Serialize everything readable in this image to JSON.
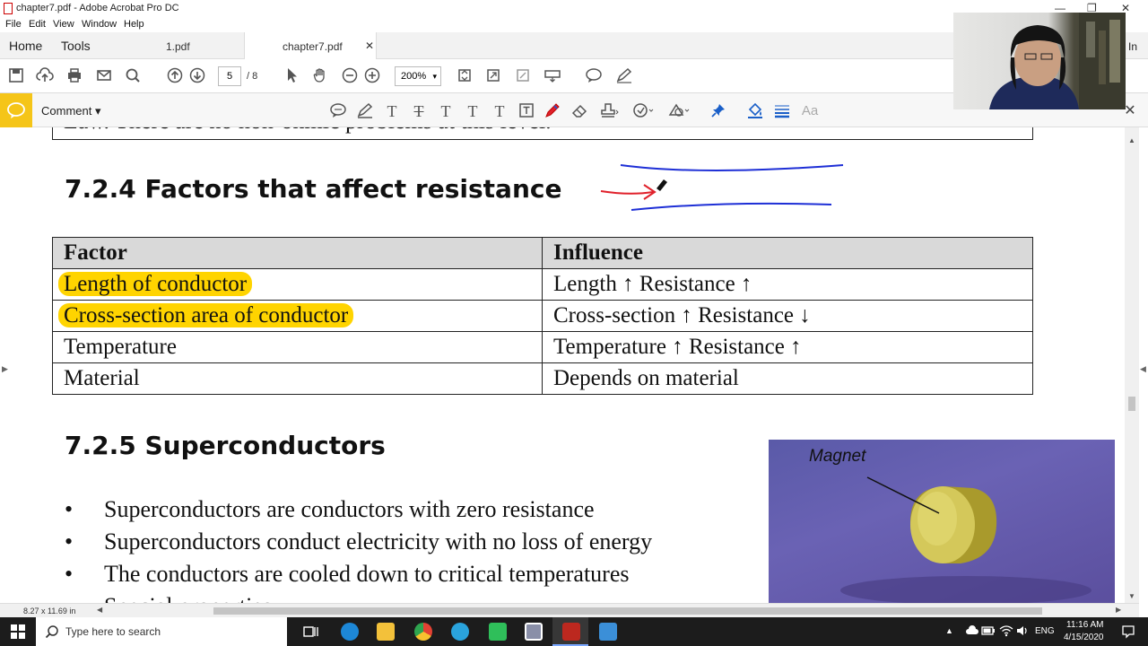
{
  "window": {
    "title": "chapter7.pdf - Adobe Acrobat Pro DC",
    "controls": {
      "minimize": "—",
      "restore": "❐",
      "close": "✕"
    }
  },
  "menu": [
    "File",
    "Edit",
    "View",
    "Window",
    "Help"
  ],
  "nav_tabs": {
    "home": "Home",
    "tools": "Tools"
  },
  "doc_tabs": [
    {
      "label": "1.pdf",
      "active": false
    },
    {
      "label": "chapter7.pdf",
      "active": true,
      "close": "✕"
    }
  ],
  "share_label": "In",
  "toolbar": {
    "page_current": "5",
    "page_total": "/ 8",
    "zoom": "200%",
    "zoom_arrow": "▾"
  },
  "comment_bar": {
    "label": "Comment ▾",
    "font_tool": "Aa",
    "close": "✕"
  },
  "document": {
    "top_line_text": "Law. There are no non-ohmic problems at this level.",
    "section1_heading": "7.2.4  Factors that affect resistance",
    "table": {
      "headers": [
        "Factor",
        "Influence"
      ],
      "rows": [
        {
          "factor": "Length of conductor",
          "influence": "Length ↑ Resistance ↑",
          "highlighted": true
        },
        {
          "factor": "Cross-section area of conductor",
          "influence": "Cross-section ↑ Resistance ↓",
          "highlighted": true
        },
        {
          "factor": "Temperature",
          "influence": "Temperature ↑ Resistance ↑",
          "highlighted": false
        },
        {
          "factor": "Material",
          "influence": "Depends on material",
          "highlighted": false
        }
      ]
    },
    "section2_heading": "7.2.5  Superconductors",
    "bullets": [
      "Superconductors are conductors with zero resistance",
      "Superconductors conduct electricity with no loss of energy",
      "The conductors are cooled down to critical temperatures",
      "Special properties"
    ],
    "image_label": "Magnet"
  },
  "status": {
    "page_size": "8.27 x 11.69 in"
  },
  "taskbar": {
    "search_placeholder": "Type here to search",
    "language": "ENG",
    "time": "11:16 AM",
    "date": "4/15/2020"
  },
  "colors": {
    "highlight": "#ffd400",
    "comment_accent": "#f5c518",
    "annotation_blue": "#1e2fd6",
    "annotation_red": "#e0202a",
    "table_header_bg": "#d9d9d9"
  }
}
